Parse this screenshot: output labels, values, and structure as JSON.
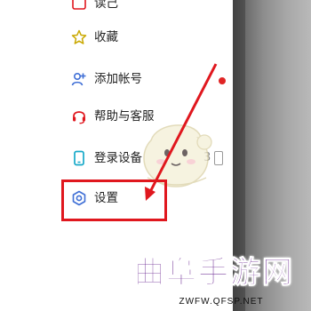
{
  "menu": {
    "items": [
      {
        "label": "读己",
        "icon": "read-history-icon"
      },
      {
        "label": "收藏",
        "icon": "star-icon"
      },
      {
        "label": "添加帐号",
        "icon": "add-user-icon"
      },
      {
        "label": "帮助与客服",
        "icon": "headset-icon"
      },
      {
        "label": "登录设备",
        "icon": "phone-icon",
        "count": "3"
      },
      {
        "label": "设置",
        "icon": "gear-icon"
      }
    ]
  },
  "watermark": {
    "title": "曲阜手游网",
    "url": "ZWFW.QFSP.NET"
  },
  "colors": {
    "accent_blue": "#3f6fd6",
    "highlight_red": "#e0171e",
    "watermark_purple": "#5a0f85",
    "badge_red": "#e02424"
  }
}
